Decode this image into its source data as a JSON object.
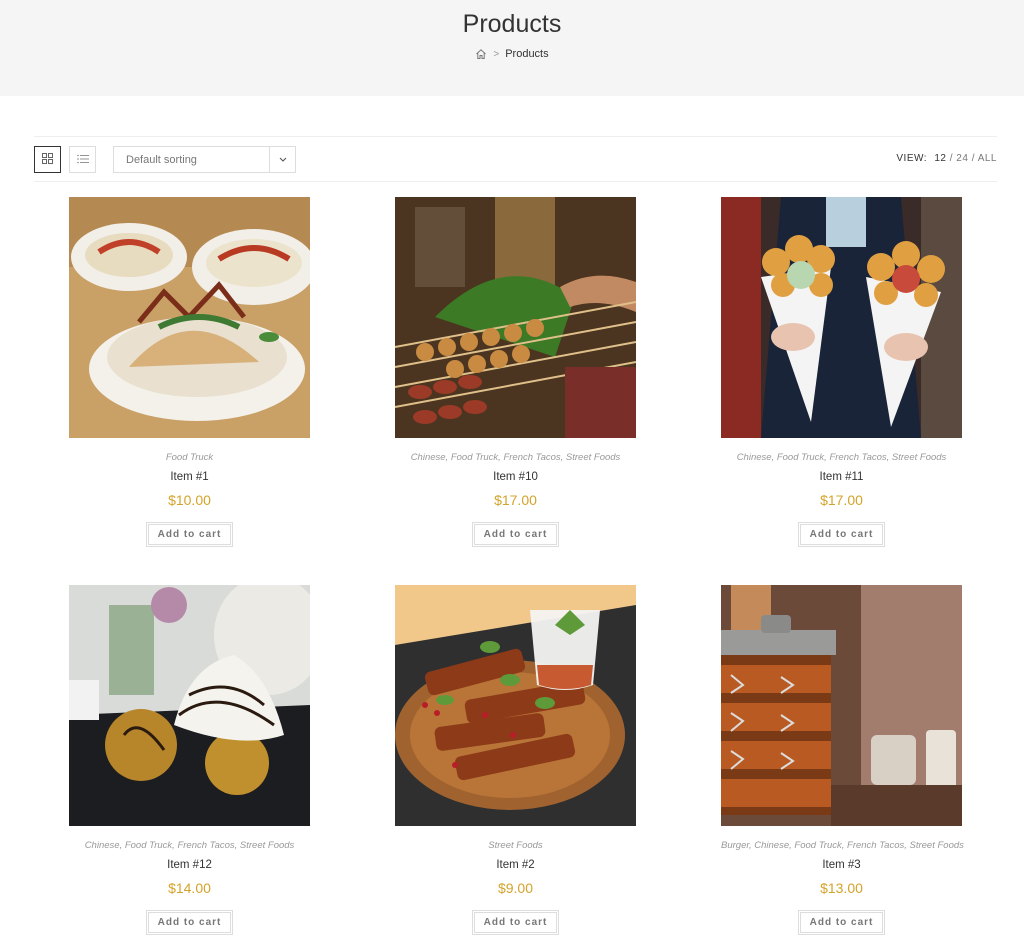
{
  "header": {
    "title": "Products",
    "breadcrumb": {
      "home_icon": "home-icon",
      "separator": ">",
      "current": "Products"
    }
  },
  "toolbar": {
    "grid_icon": "grid-view-icon",
    "list_icon": "list-view-icon",
    "sorting": "Default sorting",
    "view_label": "VIEW:",
    "view_options": [
      "12",
      "24",
      "ALL"
    ],
    "view_separator": "/"
  },
  "products": [
    {
      "categories": "Food Truck",
      "name": "Item #1",
      "price": "$10.00",
      "button": "Add to cart",
      "image": "food-image"
    },
    {
      "categories": "Chinese, Food Truck, French Tacos, Street Foods",
      "name": "Item #10",
      "price": "$17.00",
      "button": "Add to cart",
      "image": "food-image"
    },
    {
      "categories": "Chinese, Food Truck, French Tacos, Street Foods",
      "name": "Item #11",
      "price": "$17.00",
      "button": "Add to cart",
      "image": "food-image"
    },
    {
      "categories": "Chinese, Food Truck, French Tacos, Street Foods",
      "name": "Item #12",
      "price": "$14.00",
      "button": "Add to cart",
      "image": "food-image"
    },
    {
      "categories": "Street Foods",
      "name": "Item #2",
      "price": "$9.00",
      "button": "Add to cart",
      "image": "food-image"
    },
    {
      "categories": "Burger, Chinese, Food Truck, French Tacos, Street Foods",
      "name": "Item #3",
      "price": "$13.00",
      "button": "Add to cart",
      "image": "food-image"
    }
  ],
  "colors": {
    "price": "#d4a32a",
    "header_bg": "#f5f5f5"
  }
}
